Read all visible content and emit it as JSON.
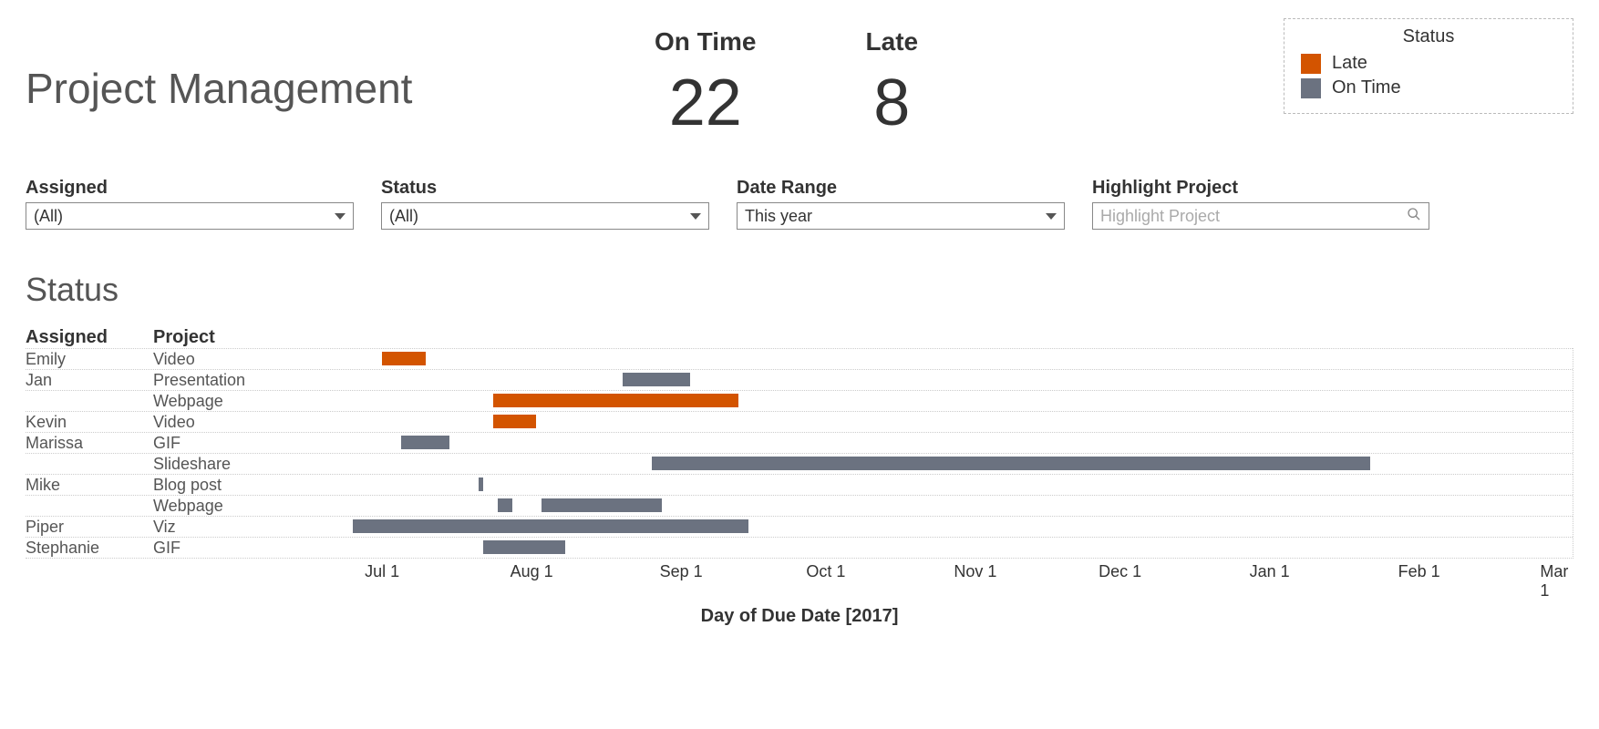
{
  "title": "Project Management",
  "kpis": {
    "ontime": {
      "label": "On Time",
      "value": "22"
    },
    "late": {
      "label": "Late",
      "value": "8"
    }
  },
  "legend": {
    "title": "Status",
    "items": [
      {
        "label": "Late",
        "color": "#d35400"
      },
      {
        "label": "On Time",
        "color": "#6b7280"
      }
    ]
  },
  "filters": {
    "assigned": {
      "label": "Assigned",
      "value": "(All)"
    },
    "status": {
      "label": "Status",
      "value": "(All)"
    },
    "daterange": {
      "label": "Date Range",
      "value": "This year"
    },
    "highlight": {
      "label": "Highlight Project",
      "placeholder": "Highlight Project"
    }
  },
  "section_title": "Status",
  "headers": {
    "assigned": "Assigned",
    "project": "Project"
  },
  "xlabel": "Day of Due Date [2017]",
  "colors": {
    "late": "#d35400",
    "ontime": "#6b7280"
  },
  "chart_data": {
    "type": "bar",
    "title": "Status",
    "xlabel": "Day of Due Date [2017]",
    "ylabel": "",
    "x_range": [
      "2017-06-10",
      "2018-03-05"
    ],
    "ticks": [
      "Jul 1",
      "Aug 1",
      "Sep 1",
      "Oct 1",
      "Nov 1",
      "Dec 1",
      "Jan 1",
      "Feb 1",
      "Mar 1"
    ],
    "legend": [
      "Late",
      "On Time"
    ],
    "rows": [
      {
        "assigned": "Emily",
        "project": "Video",
        "status": "Late",
        "start": "2017-07-01",
        "end": "2017-07-10"
      },
      {
        "assigned": "Jan",
        "project": "Presentation",
        "status": "On Time",
        "start": "2017-08-20",
        "end": "2017-09-03"
      },
      {
        "assigned": "Jan",
        "project": "Webpage",
        "status": "Late",
        "start": "2017-07-24",
        "end": "2017-09-13"
      },
      {
        "assigned": "Kevin",
        "project": "Video",
        "status": "Late",
        "start": "2017-07-24",
        "end": "2017-08-02"
      },
      {
        "assigned": "Marissa",
        "project": "GIF",
        "status": "On Time",
        "start": "2017-07-05",
        "end": "2017-07-15"
      },
      {
        "assigned": "Marissa",
        "project": "Slideshare",
        "status": "On Time",
        "start": "2017-08-26",
        "end": "2018-01-22"
      },
      {
        "assigned": "Mike",
        "project": "Blog post",
        "status": "On Time",
        "start": "2017-07-21",
        "end": "2017-07-22"
      },
      {
        "assigned": "Mike",
        "project": "Webpage",
        "status": "On Time",
        "start": "2017-07-25",
        "end": "2017-07-28"
      },
      {
        "assigned": "Mike",
        "project": "Webpage",
        "status": "On Time",
        "start": "2017-08-03",
        "end": "2017-08-28"
      },
      {
        "assigned": "Piper",
        "project": "Viz",
        "status": "On Time",
        "start": "2017-06-25",
        "end": "2017-09-15"
      },
      {
        "assigned": "Stephanie",
        "project": "GIF",
        "status": "On Time",
        "start": "2017-07-22",
        "end": "2017-08-08"
      }
    ]
  }
}
